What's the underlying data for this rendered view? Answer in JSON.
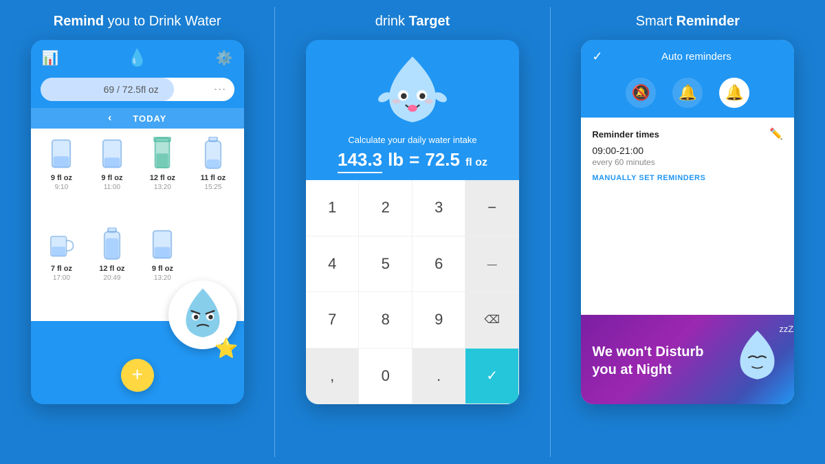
{
  "panels": [
    {
      "title_normal": "you to Drink Water",
      "title_bold": "Remind",
      "progress_text": "69 / 72.5fl oz",
      "day_label": "TODAY",
      "drinks": [
        {
          "icon": "🥛",
          "label": "9 fl oz",
          "time": "9:10"
        },
        {
          "icon": "🥛",
          "label": "9 fl oz",
          "time": "11:00"
        },
        {
          "icon": "🧃",
          "label": "12 fl oz",
          "time": "13:20"
        },
        {
          "icon": "🍶",
          "label": "11 fl oz",
          "time": "15:25"
        },
        {
          "icon": "☕",
          "label": "7 fl oz",
          "time": "17:00"
        },
        {
          "icon": "🍶",
          "label": "12 fl oz",
          "time": "20:49"
        },
        {
          "icon": "🥛",
          "label": "9 fl oz",
          "time": "13:20"
        },
        {
          "icon": "",
          "label": "",
          "time": ""
        }
      ],
      "fab_label": "+"
    },
    {
      "title_normal": "drink",
      "title_bold": "Target",
      "subtitle": "Calculate your daily water intake",
      "weight_val": "143.3",
      "weight_unit": "lb",
      "equals": "=",
      "water_val": "72.5",
      "water_unit": "fl oz",
      "keys": [
        {
          "label": "1",
          "type": "num"
        },
        {
          "label": "2",
          "type": "num"
        },
        {
          "label": "3",
          "type": "num"
        },
        {
          "label": "−",
          "type": "special"
        },
        {
          "label": "4",
          "type": "num"
        },
        {
          "label": "5",
          "type": "num"
        },
        {
          "label": "6",
          "type": "num"
        },
        {
          "label": "—",
          "type": "special"
        },
        {
          "label": "7",
          "type": "num"
        },
        {
          "label": "8",
          "type": "num"
        },
        {
          "label": "9",
          "type": "num"
        },
        {
          "label": "⌫",
          "type": "backspace"
        },
        {
          "label": ",",
          "type": "special"
        },
        {
          "label": "0",
          "type": "num"
        },
        {
          "label": ".",
          "type": "special"
        },
        {
          "label": "✓",
          "type": "confirm"
        }
      ]
    },
    {
      "title_normal": "Smart",
      "title_bold": "Reminder",
      "auto_reminders": "Auto reminders",
      "reminder_times_label": "Reminder times",
      "time_range": "09:00-21:00",
      "interval": "every 60 minutes",
      "manual_link": "MANUALLY SET REMINDERS",
      "night_text": "We won't Disturb you at Night"
    }
  ]
}
